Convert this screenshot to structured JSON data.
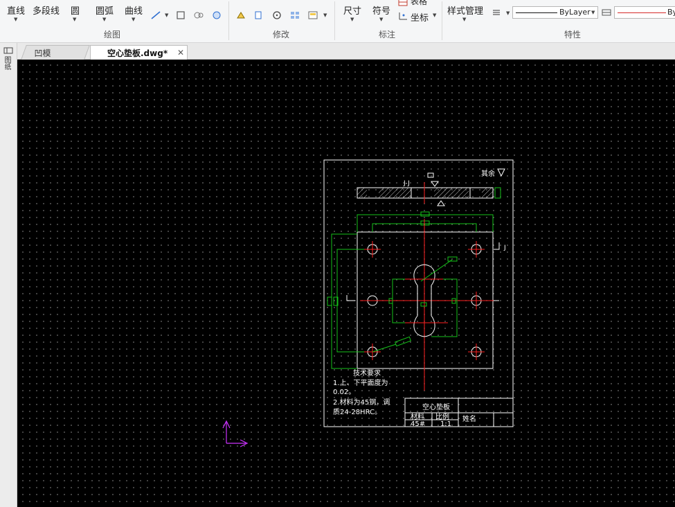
{
  "ribbon": {
    "draw_group": {
      "label": "绘图",
      "line": "直线",
      "polyline": "多段线",
      "circle": "圆",
      "arc": "圆弧",
      "curve": "曲线"
    },
    "modify_group": {
      "label": "修改"
    },
    "annotate_group": {
      "label": "标注",
      "dimension": "尺寸",
      "symbol": "符号",
      "table": "表格",
      "coordinate": "坐标"
    },
    "properties_group": {
      "label": "特性",
      "style_manager": "样式管理",
      "linetype_value": "ByLayer",
      "color_value": "By"
    }
  },
  "tabs": [
    {
      "label": "凹模板.dwg",
      "active": false
    },
    {
      "label": "空心垫板.dwg*",
      "active": true
    }
  ],
  "left_panel": {
    "toggle_label": "图纸"
  },
  "drawing": {
    "section_label": "J-J",
    "roughness_note": "其余",
    "tech_requirements": {
      "title": "技术要求",
      "lines": [
        "1.上、下平面度为",
        "0.02。",
        "2.材料为45钢，调",
        "质24-28HRC。"
      ]
    },
    "title_block": {
      "part_name": "空心垫板",
      "material_label": "材料",
      "material_value": "45#",
      "scale_label": "比例",
      "scale_value": "1:1",
      "name_label": "姓名"
    },
    "side_mark": "J"
  },
  "colors": {
    "canvas_bg": "#000000",
    "draw_white": "#ffffff",
    "dim_green": "#16c21a",
    "center_red": "#ff2020",
    "ucs_magenta": "#cc33ff"
  }
}
